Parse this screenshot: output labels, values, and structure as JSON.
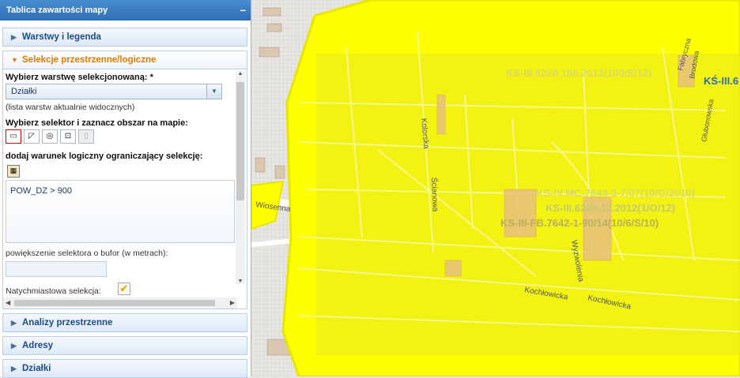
{
  "panel": {
    "title": "Tablica zawartości mapy",
    "collapse": "–",
    "sections": {
      "layers": "Warstwy i legenda",
      "selection": "Selekcje przestrzenne/logiczne",
      "analyses": "Analizy przestrzenne",
      "addresses": "Adresy",
      "parcels": "Działki"
    }
  },
  "selection_form": {
    "layer_label": "Wybierz warstwę selekcjonowaną: *",
    "layer_value": "Działki",
    "layer_note": "(lista warstw aktualnie widocznych)",
    "selector_label": "Wybierz selektor i zaznacz obszar na mapie:",
    "condition_label": "dodaj warunek logiczny ograniczający selekcję:",
    "condition_value": "POW_DZ > 900",
    "buffer_label": "powiększenie selektora o bufor (w metrach):",
    "buffer_value": "",
    "instant_label": "Natychmiastowa selekcja:",
    "instant_checked": true
  },
  "map": {
    "labels": {
      "ks1": "KS-III.6220.166.2012(100/S/12)",
      "ks1_cut": "KŚ-III.6",
      "ks2": "KS-IV.MC-7644-3-7/07(10/O/2010)",
      "ks3": "KS-III.6220.12.2012(1/O/12)",
      "ks4": "KS-III-FB.7642-1-90/14(10/6/S/10)",
      "kolorska": "Kolorska",
      "scianowa": "Ścianowa",
      "wiosenna": "Wiosenna",
      "wyzwolenia": "Wyzwolenia",
      "kochlowicka1": "Kochłowicka",
      "kochlowicka2": "Kochłowicka",
      "fabryczna": "Fabryczna",
      "brodowa": "Brodowa",
      "glubonowska": "Głubonowska"
    },
    "colors": {
      "selection": "#ffff00",
      "outline": "#e6e600",
      "base": "#e8e6e2",
      "building": "#d9c7b0"
    }
  }
}
